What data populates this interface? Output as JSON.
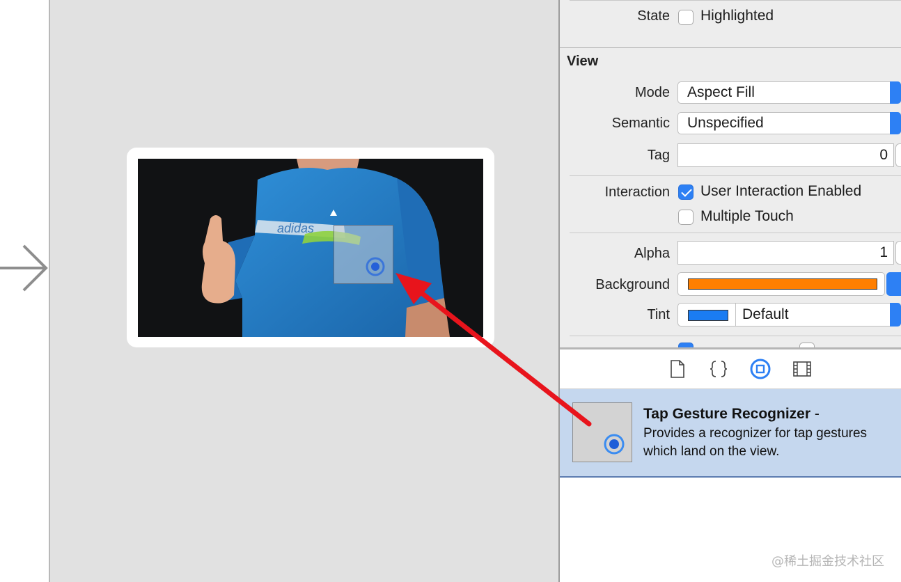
{
  "inspector": {
    "state": {
      "label": "State",
      "option": "Highlighted",
      "checked": false
    },
    "view_section": {
      "title": "View"
    },
    "mode": {
      "label": "Mode",
      "value": "Aspect Fill"
    },
    "semantic": {
      "label": "Semantic",
      "value": "Unspecified"
    },
    "tag": {
      "label": "Tag",
      "value": "0"
    },
    "interaction": {
      "label": "Interaction",
      "user_interaction": {
        "text": "User Interaction Enabled",
        "checked": true
      },
      "multiple_touch": {
        "text": "Multiple Touch",
        "checked": false
      }
    },
    "alpha": {
      "label": "Alpha",
      "value": "1"
    },
    "background": {
      "label": "Background",
      "color": "#ff7f00"
    },
    "tint": {
      "label": "Tint",
      "color": "#1a7cf2",
      "value": "Default"
    }
  },
  "library": {
    "tabs": [
      "file-icon",
      "braces-icon",
      "object-icon",
      "media-icon"
    ],
    "selected_tab": "object-icon",
    "item": {
      "title": "Tap Gesture Recognizer",
      "dash": "-",
      "description_line1": "Provides a recognizer for tap gestures",
      "description_line2": "which land on the view."
    }
  },
  "canvas": {
    "image_label": "adidas"
  },
  "watermark": "@稀土掘金技术社区",
  "colors": {
    "accent": "#2d80f4",
    "arrow": "#e8141c",
    "selection": "#c5d7ee"
  }
}
